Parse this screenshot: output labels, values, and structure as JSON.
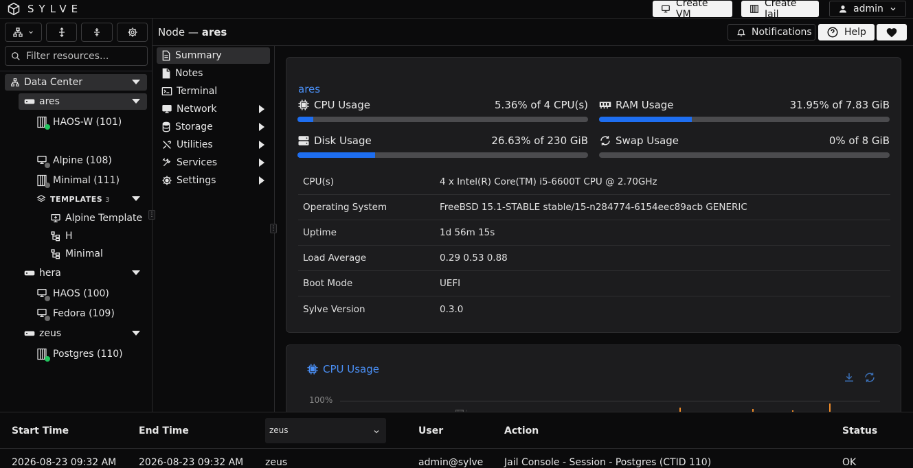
{
  "app": {
    "brand": "SYLVE"
  },
  "topbar": {
    "create_vm": "Create VM",
    "create_jail": "Create Jail",
    "user": "admin"
  },
  "sidebar": {
    "filter_placeholder": "Filter resources...",
    "datacenter": "Data Center",
    "nodes": [
      {
        "name": "ares",
        "items": [
          {
            "label": "HAOS-W (101)",
            "type": "jail",
            "status": "running"
          },
          {
            "label": "Alpine (108)",
            "type": "vm",
            "status": "stopped"
          },
          {
            "label": "Minimal (111)",
            "type": "jail",
            "status": "stopped"
          }
        ],
        "templates_label": "TEMPLATES",
        "templates_count": "3",
        "templates": [
          {
            "label": "Alpine Template"
          },
          {
            "label": "H"
          },
          {
            "label": "Minimal"
          }
        ]
      },
      {
        "name": "hera",
        "items": [
          {
            "label": "HAOS (100)",
            "type": "vm",
            "status": "stopped"
          },
          {
            "label": "Fedora (109)",
            "type": "vm",
            "status": "stopped"
          }
        ]
      },
      {
        "name": "zeus",
        "items": [
          {
            "label": "Postgres (110)",
            "type": "jail",
            "status": "running"
          }
        ]
      }
    ]
  },
  "header": {
    "title_prefix": "Node —",
    "title_node": "ares",
    "notifications": "Notifications",
    "help": "Help"
  },
  "menu": {
    "items": [
      {
        "label": "Summary",
        "icon": "file-icon",
        "selected": true,
        "submenu": false
      },
      {
        "label": "Notes",
        "icon": "notes-icon",
        "selected": false,
        "submenu": false
      },
      {
        "label": "Terminal",
        "icon": "terminal-icon",
        "selected": false,
        "submenu": false
      },
      {
        "label": "Network",
        "icon": "monitor-icon",
        "selected": false,
        "submenu": true
      },
      {
        "label": "Storage",
        "icon": "database-icon",
        "selected": false,
        "submenu": true
      },
      {
        "label": "Utilities",
        "icon": "tools-icon",
        "selected": false,
        "submenu": true
      },
      {
        "label": "Services",
        "icon": "wrench-icon",
        "selected": false,
        "submenu": true
      },
      {
        "label": "Settings",
        "icon": "gear-icon",
        "selected": false,
        "submenu": true
      }
    ]
  },
  "summary": {
    "host": "ares",
    "metrics": [
      {
        "label": "CPU Usage",
        "value": "5.36% of 4 CPU(s)",
        "percent": 5.36,
        "icon": "cpu-icon"
      },
      {
        "label": "RAM Usage",
        "value": "31.95% of 7.83 GiB",
        "percent": 31.95,
        "icon": "ram-icon"
      },
      {
        "label": "Disk Usage",
        "value": "26.63% of 230 GiB",
        "percent": 26.63,
        "icon": "disk-icon"
      },
      {
        "label": "Swap Usage",
        "value": "0% of 8 GiB",
        "percent": 0,
        "icon": "swap-icon"
      }
    ],
    "info": [
      {
        "key": "CPU(s)",
        "value": "4 x Intel(R) Core(TM) i5-6600T CPU @ 2.70GHz"
      },
      {
        "key": "Operating System",
        "value": "FreeBSD 15.1-STABLE stable/15-n284774-6154eec89acb GENERIC"
      },
      {
        "key": "Uptime",
        "value": "1d 56m 15s"
      },
      {
        "key": "Load Average",
        "value": "0.29 0.53 0.88"
      },
      {
        "key": "Boot Mode",
        "value": "UEFI"
      },
      {
        "key": "Sylve Version",
        "value": "0.3.0"
      }
    ]
  },
  "cpu_chart": {
    "title": "CPU Usage",
    "ytick": "100%"
  },
  "audit": {
    "headers": {
      "start": "Start Time",
      "end": "End Time",
      "user": "User",
      "action": "Action",
      "status": "Status"
    },
    "node_filter": "zeus",
    "rows": [
      {
        "start": "2026-08-23 09:32 AM",
        "end": "2026-08-23 09:32 AM",
        "node": "zeus",
        "user": "admin@sylve",
        "action": "Jail Console - Session - Postgres (CTID 110)",
        "status": "OK"
      }
    ]
  },
  "colors": {
    "accent": "#1e6ef0",
    "link": "#4a8ff5",
    "running": "#22c55e",
    "stopped": "#6b6b6b",
    "chart_line": "#f08c2a"
  }
}
